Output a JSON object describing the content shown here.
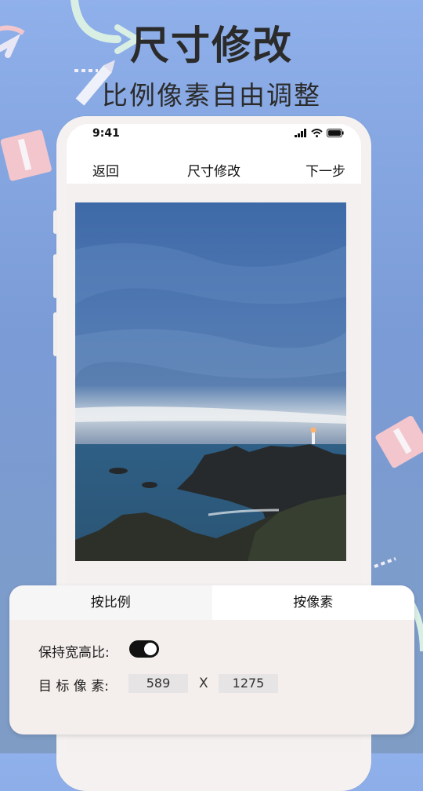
{
  "promo": {
    "title": "尺寸修改",
    "subtitle": "比例像素自由调整"
  },
  "phone": {
    "status_time": "9:41",
    "nav": {
      "back_label": "返回",
      "title": "尺寸修改",
      "next_label": "下一步"
    },
    "photo": {
      "subject": "coastal lighthouse at dusk"
    }
  },
  "panel": {
    "tabs": [
      {
        "label": "按比例",
        "active": true
      },
      {
        "label": "按像素",
        "active": false
      }
    ],
    "keep_ratio_label": "保持宽高比:",
    "keep_ratio_on": true,
    "target_pixels_label": "目 标 像 素:",
    "width_value": "589",
    "separator": "X",
    "height_value": "1275"
  },
  "colors": {
    "background_top": "#8fb0ea",
    "background_bottom": "#7e9cc4",
    "toggle_on": "#111111",
    "deco_pink": "#f2c6cc",
    "deco_mint": "#d9efe4"
  }
}
